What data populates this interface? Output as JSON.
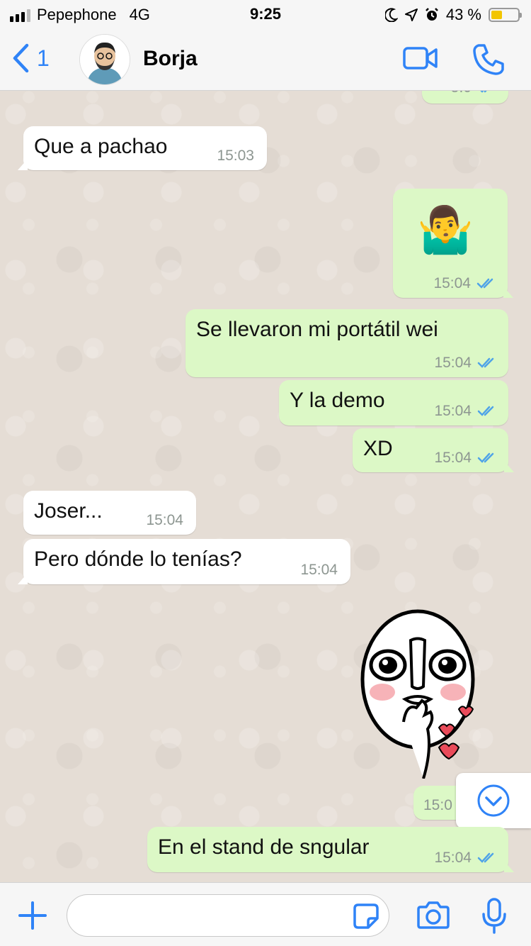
{
  "status_bar": {
    "carrier": "Pepephone",
    "network": "4G",
    "time": "9:25",
    "battery_text": "43 %",
    "battery_level": 0.43,
    "battery_color": "#f2c500"
  },
  "header": {
    "back_count": "1",
    "contact_name": "Borja",
    "accent_color": "#2f83f7",
    "icons": [
      "chevron-left-icon",
      "video-call-icon",
      "phone-icon"
    ]
  },
  "messages": [
    {
      "text": "Que a pachao",
      "time": "15:03",
      "direction": "incoming"
    },
    {
      "text": "🤷‍♂️",
      "time": "15:04",
      "direction": "outgoing",
      "status": "read"
    },
    {
      "text": "Se llevaron mi portátil wei",
      "time": "15:04",
      "direction": "outgoing",
      "status": "read"
    },
    {
      "text": "Y la demo",
      "time": "15:04",
      "direction": "outgoing",
      "status": "read"
    },
    {
      "text": "XD",
      "time": "15:04",
      "direction": "outgoing",
      "status": "read"
    },
    {
      "text": "Joser...",
      "time": "15:04",
      "direction": "incoming"
    },
    {
      "text": "Pero dónde lo tenías?",
      "time": "15:04",
      "direction": "incoming"
    },
    {
      "text": "",
      "time": "15:0",
      "direction": "outgoing",
      "type": "sticker"
    },
    {
      "text": "En el stand de sngular",
      "time": "15:04",
      "direction": "outgoing",
      "status": "read"
    }
  ],
  "partial_top_time": "5:0",
  "input_bar": {
    "placeholder": "",
    "icons": [
      "plus-icon",
      "sticker-icon",
      "camera-icon",
      "microphone-icon"
    ]
  },
  "colors": {
    "outgoing_bubble": "#dcf8c6",
    "incoming_bubble": "#ffffff",
    "chat_background": "#e5ddd5",
    "read_ticks": "#4fa3e8"
  }
}
